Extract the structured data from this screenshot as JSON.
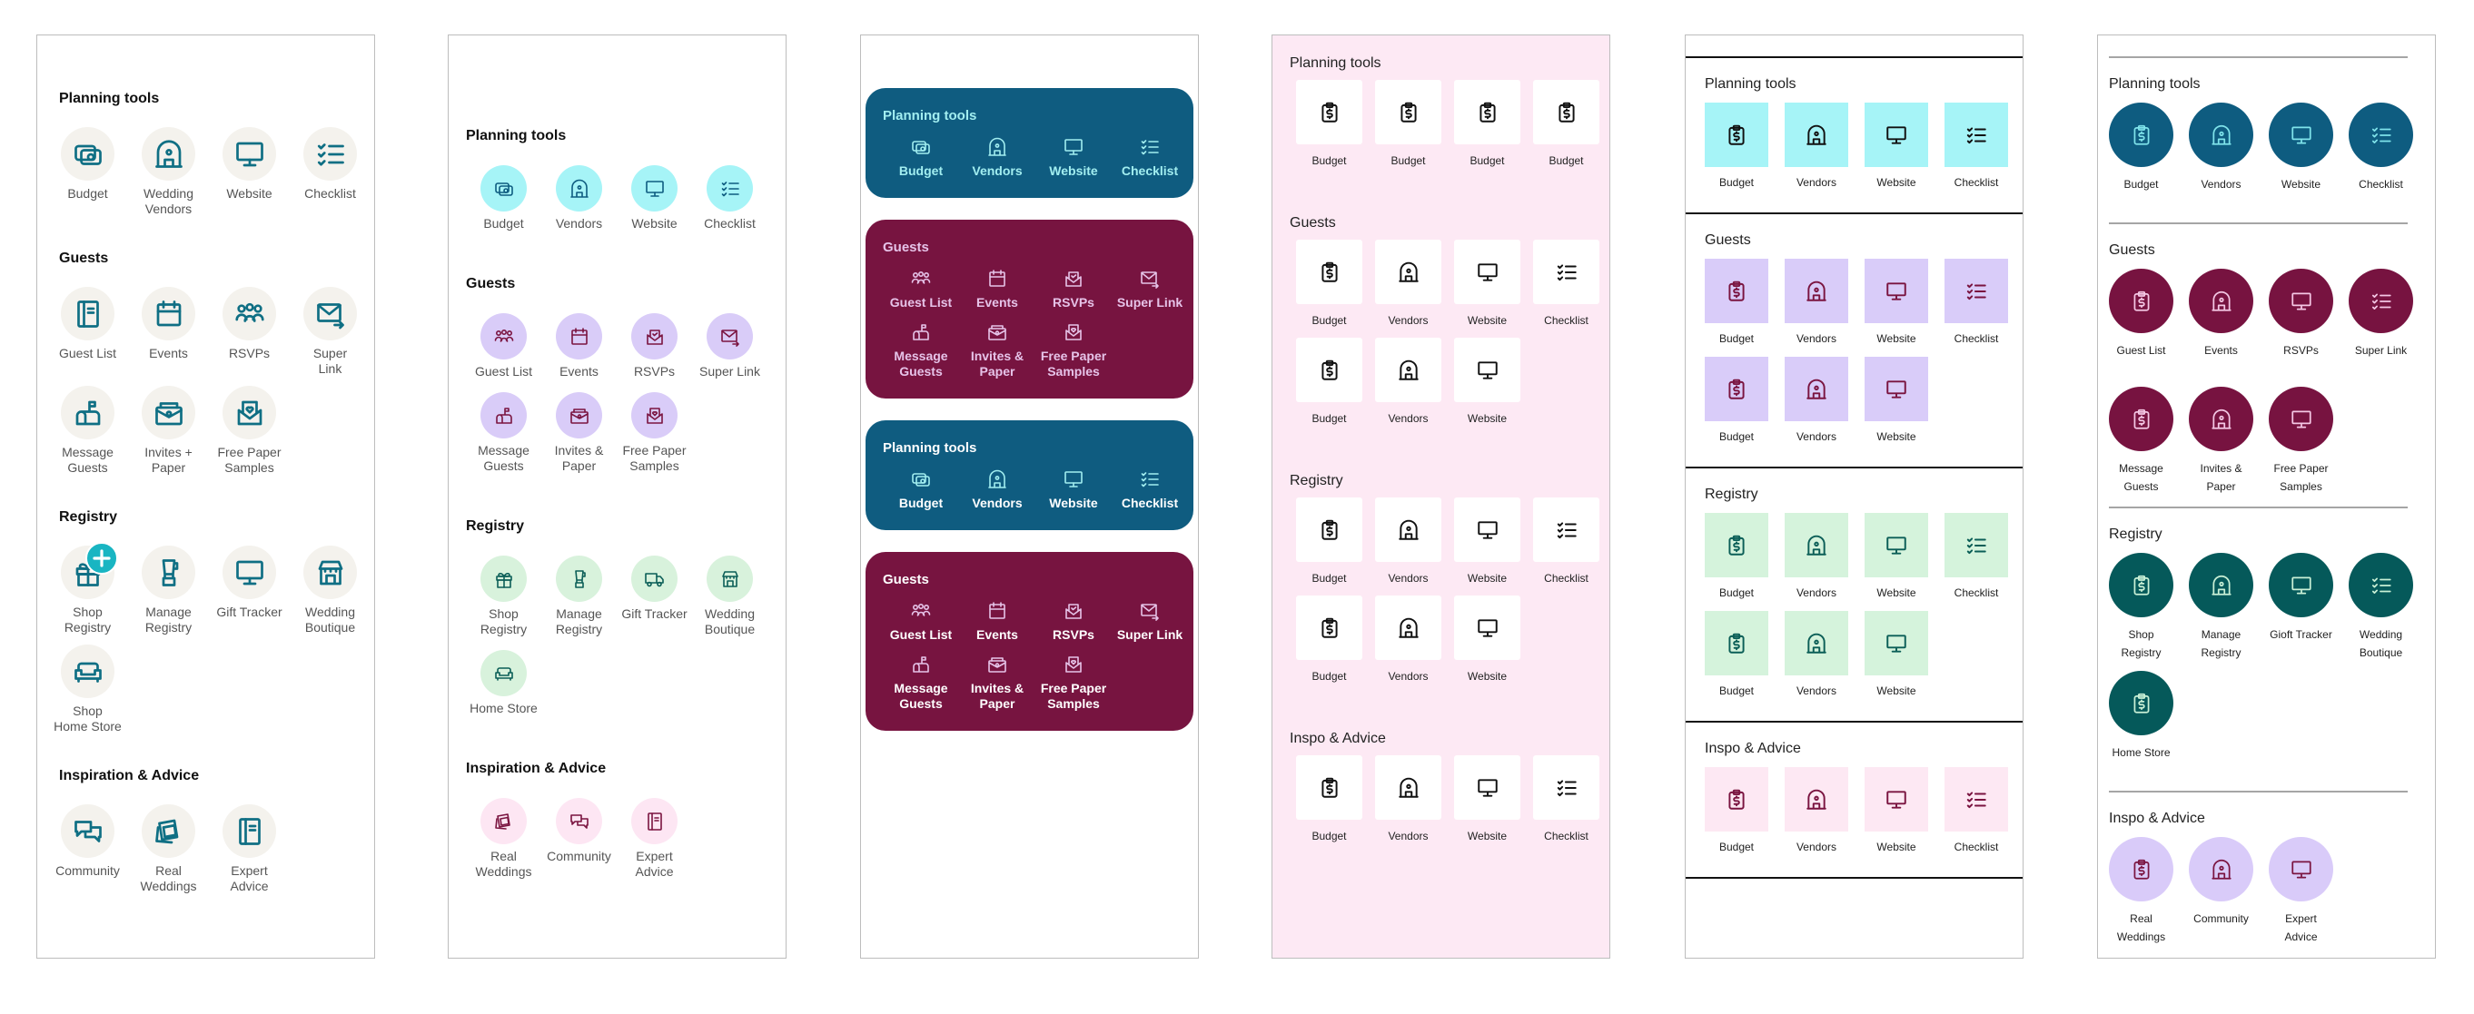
{
  "panels": [
    {
      "variant": "illustrated",
      "sections": [
        {
          "title": "Planning tools",
          "items": [
            {
              "label": "Budget",
              "icon": "money"
            },
            {
              "label": "Wedding\nVendors",
              "icon": "vendors"
            },
            {
              "label": "Website",
              "icon": "website"
            },
            {
              "label": "Checklist",
              "icon": "checklist"
            }
          ]
        },
        {
          "title": "Guests",
          "items": [
            {
              "label": "Guest List",
              "icon": "book"
            },
            {
              "label": "Events",
              "icon": "events"
            },
            {
              "label": "RSVPs",
              "icon": "guests"
            },
            {
              "label": "Super\nLink",
              "icon": "superlink"
            },
            {
              "label": "Message\nGuests",
              "icon": "mailbox"
            },
            {
              "label": "Invites +\nPaper",
              "icon": "invites"
            },
            {
              "label": "Free Paper\nSamples",
              "icon": "samples"
            }
          ]
        },
        {
          "title": "Registry",
          "items": [
            {
              "label": "Shop\nRegistry",
              "icon": "gift",
              "badge": "plus"
            },
            {
              "label": "Manage\nRegistry",
              "icon": "blender"
            },
            {
              "label": "Gift Tracker",
              "icon": "website"
            },
            {
              "label": "Wedding\nBoutique",
              "icon": "store"
            },
            {
              "label": "Shop\nHome Store",
              "icon": "sofa"
            }
          ]
        },
        {
          "title": "Inspiration & Advice",
          "items": [
            {
              "label": "Community",
              "icon": "community"
            },
            {
              "label": "Real\nWeddings",
              "icon": "photos"
            },
            {
              "label": "Expert\nAdvice",
              "icon": "book"
            }
          ]
        }
      ],
      "colors": {
        "icon": "#0f6f84",
        "circle": "#f4f2ed"
      }
    },
    {
      "variant": "circle-pastel",
      "sections": [
        {
          "title": "Planning tools",
          "bg": "#a6f4f7",
          "fg": "#0e5c80",
          "items": [
            {
              "label": "Budget",
              "icon": "money"
            },
            {
              "label": "Vendors",
              "icon": "vendors"
            },
            {
              "label": "Website",
              "icon": "website"
            },
            {
              "label": "Checklist",
              "icon": "checklist"
            }
          ]
        },
        {
          "title": "Guests",
          "bg": "#d9ccf8",
          "fg": "#7a1440",
          "items": [
            {
              "label": "Guest List",
              "icon": "guests"
            },
            {
              "label": "Events",
              "icon": "events"
            },
            {
              "label": "RSVPs",
              "icon": "rsvps"
            },
            {
              "label": "Super Link",
              "icon": "superlink"
            },
            {
              "label": "Message\nGuests",
              "icon": "mailbox"
            },
            {
              "label": "Invites &\nPaper",
              "icon": "invites"
            },
            {
              "label": "Free Paper\nSamples",
              "icon": "samples"
            }
          ]
        },
        {
          "title": "Registry",
          "bg": "#d8f2dc",
          "fg": "#0b5e57",
          "items": [
            {
              "label": "Shop\nRegistry",
              "icon": "gift"
            },
            {
              "label": "Manage\nRegistry",
              "icon": "blender"
            },
            {
              "label": "Gift Tracker",
              "icon": "truck"
            },
            {
              "label": "Wedding\nBoutique",
              "icon": "store"
            },
            {
              "label": "Home Store",
              "icon": "sofa"
            }
          ]
        },
        {
          "title": "Inspiration & Advice",
          "bg": "#fde6f3",
          "fg": "#7a1440",
          "items": [
            {
              "label": "Real\nWeddings",
              "icon": "photos"
            },
            {
              "label": "Community",
              "icon": "community"
            },
            {
              "label": "Expert\nAdvice",
              "icon": "book"
            }
          ]
        }
      ]
    },
    {
      "variant": "cards",
      "sections": [
        {
          "title": "Planning tools",
          "bg": "#0f5c80",
          "title_color": "#a2eef0",
          "label_color": "#a2eef0",
          "fg": "#a2eef0",
          "items": [
            {
              "label": "Budget",
              "icon": "money"
            },
            {
              "label": "Vendors",
              "icon": "vendors"
            },
            {
              "label": "Website",
              "icon": "website"
            },
            {
              "label": "Checklist",
              "icon": "checklist"
            }
          ]
        },
        {
          "title": "Guests",
          "bg": "#771440",
          "title_color": "#e6c3e8",
          "label_color": "#e6c3e8",
          "fg": "#e6c3e8",
          "items": [
            {
              "label": "Guest List",
              "icon": "guests"
            },
            {
              "label": "Events",
              "icon": "events"
            },
            {
              "label": "RSVPs",
              "icon": "rsvps"
            },
            {
              "label": "Super Link",
              "icon": "superlink"
            },
            {
              "label": "Message\nGuests",
              "icon": "mailbox"
            },
            {
              "label": "Invites &\nPaper",
              "icon": "invites"
            },
            {
              "label": "Free Paper\nSamples",
              "icon": "samples"
            }
          ]
        },
        {
          "title": "Planning tools",
          "bg": "#0f5c80",
          "title_color": "#ffffff",
          "label_color": "#ffffff",
          "fg": "#a2eef0",
          "items": [
            {
              "label": "Budget",
              "icon": "money"
            },
            {
              "label": "Vendors",
              "icon": "vendors"
            },
            {
              "label": "Website",
              "icon": "website"
            },
            {
              "label": "Checklist",
              "icon": "checklist"
            }
          ]
        },
        {
          "title": "Guests",
          "bg": "#771440",
          "title_color": "#ffffff",
          "label_color": "#ffffff",
          "fg": "#e6c3e8",
          "items": [
            {
              "label": "Guest List",
              "icon": "guests"
            },
            {
              "label": "Events",
              "icon": "events"
            },
            {
              "label": "RSVPs",
              "icon": "rsvps"
            },
            {
              "label": "Super Link",
              "icon": "superlink"
            },
            {
              "label": "Message\nGuests",
              "icon": "mailbox"
            },
            {
              "label": "Invites &\nPaper",
              "icon": "invites"
            },
            {
              "label": "Free Paper\nSamples",
              "icon": "samples"
            }
          ]
        }
      ]
    },
    {
      "variant": "tiles-on-pink",
      "colors": {
        "background": "#fde9f4",
        "tile": "#ffffff",
        "icon": "#111111"
      },
      "sections": [
        {
          "title": "Planning tools",
          "items": [
            {
              "label": "Budget",
              "icon": "budget"
            },
            {
              "label": "Budget",
              "icon": "budget"
            },
            {
              "label": "Budget",
              "icon": "budget"
            },
            {
              "label": "Budget",
              "icon": "budget"
            }
          ]
        },
        {
          "title": "Guests",
          "items": [
            {
              "label": "Budget",
              "icon": "budget"
            },
            {
              "label": "Vendors",
              "icon": "vendors"
            },
            {
              "label": "Website",
              "icon": "website"
            },
            {
              "label": "Checklist",
              "icon": "checklist"
            },
            {
              "label": "Budget",
              "icon": "budget"
            },
            {
              "label": "Vendors",
              "icon": "vendors"
            },
            {
              "label": "Website",
              "icon": "website"
            }
          ]
        },
        {
          "title": "Registry",
          "items": [
            {
              "label": "Budget",
              "icon": "budget"
            },
            {
              "label": "Vendors",
              "icon": "vendors"
            },
            {
              "label": "Website",
              "icon": "website"
            },
            {
              "label": "Checklist",
              "icon": "checklist"
            },
            {
              "label": "Budget",
              "icon": "budget"
            },
            {
              "label": "Vendors",
              "icon": "vendors"
            },
            {
              "label": "Website",
              "icon": "website"
            }
          ]
        },
        {
          "title": "Inspo & Advice",
          "items": [
            {
              "label": "Budget",
              "icon": "budget"
            },
            {
              "label": "Vendors",
              "icon": "vendors"
            },
            {
              "label": "Website",
              "icon": "website"
            },
            {
              "label": "Checklist",
              "icon": "checklist"
            }
          ]
        }
      ]
    },
    {
      "variant": "tiles-colored",
      "sections": [
        {
          "title": "Planning tools",
          "bg": "#a6f4f7",
          "fg": "#111111",
          "items": [
            {
              "label": "Budget",
              "icon": "budget"
            },
            {
              "label": "Vendors",
              "icon": "vendors"
            },
            {
              "label": "Website",
              "icon": "website"
            },
            {
              "label": "Checklist",
              "icon": "checklist"
            }
          ]
        },
        {
          "title": "Guests",
          "bg": "#d9ccf9",
          "fg": "#7a1440",
          "items": [
            {
              "label": "Budget",
              "icon": "budget"
            },
            {
              "label": "Vendors",
              "icon": "vendors"
            },
            {
              "label": "Website",
              "icon": "website"
            },
            {
              "label": "Checklist",
              "icon": "checklist"
            },
            {
              "label": "Budget",
              "icon": "budget"
            },
            {
              "label": "Vendors",
              "icon": "vendors"
            },
            {
              "label": "Website",
              "icon": "website"
            }
          ]
        },
        {
          "title": "Registry",
          "bg": "#d5f3dc",
          "fg": "#0b5e57",
          "items": [
            {
              "label": "Budget",
              "icon": "budget"
            },
            {
              "label": "Vendors",
              "icon": "vendors"
            },
            {
              "label": "Website",
              "icon": "website"
            },
            {
              "label": "Checklist",
              "icon": "checklist"
            },
            {
              "label": "Budget",
              "icon": "budget"
            },
            {
              "label": "Vendors",
              "icon": "vendors"
            },
            {
              "label": "Website",
              "icon": "website"
            }
          ]
        },
        {
          "title": "Inspo & Advice",
          "bg": "#fde8f3",
          "fg": "#7a1440",
          "items": [
            {
              "label": "Budget",
              "icon": "budget"
            },
            {
              "label": "Vendors",
              "icon": "vendors"
            },
            {
              "label": "Website",
              "icon": "website"
            },
            {
              "label": "Checklist",
              "icon": "checklist"
            }
          ]
        }
      ]
    },
    {
      "variant": "circle-dark",
      "sections": [
        {
          "title": "Planning tools",
          "bg": "#0e5c80",
          "fg": "#7fe3ea",
          "items": [
            {
              "label": "Budget",
              "icon": "budget"
            },
            {
              "label": "Vendors",
              "icon": "vendors"
            },
            {
              "label": "Website",
              "icon": "website"
            },
            {
              "label": "Checklist",
              "icon": "checklist"
            }
          ]
        },
        {
          "title": "Guests",
          "bg": "#771340",
          "fg": "#f4c7e4",
          "items": [
            {
              "label": "Guest List",
              "icon": "budget"
            },
            {
              "label": "Events",
              "icon": "vendors"
            },
            {
              "label": "RSVPs",
              "icon": "website"
            },
            {
              "label": "Super Link",
              "icon": "checklist"
            },
            {
              "label": "Message\nGuests",
              "icon": "budget"
            },
            {
              "label": "Invites &\nPaper",
              "icon": "vendors"
            },
            {
              "label": "Free Paper\nSamples",
              "icon": "website"
            }
          ]
        },
        {
          "title": "Registry",
          "bg": "#05595a",
          "fg": "#c9f0d6",
          "items": [
            {
              "label": "Shop\nRegistry",
              "icon": "budget"
            },
            {
              "label": "Manage\nRegistry",
              "icon": "vendors"
            },
            {
              "label": "Gioft Tracker",
              "icon": "website"
            },
            {
              "label": "Wedding\nBoutique",
              "icon": "checklist"
            },
            {
              "label": "Home Store",
              "icon": "budget"
            }
          ]
        },
        {
          "title": "Inspo & Advice",
          "bg": "#d9cbf9",
          "fg": "#7a1440",
          "items": [
            {
              "label": "Real\nWeddings",
              "icon": "budget"
            },
            {
              "label": "Community",
              "icon": "vendors"
            },
            {
              "label": "Expert\nAdvice",
              "icon": "website"
            }
          ]
        }
      ]
    }
  ]
}
